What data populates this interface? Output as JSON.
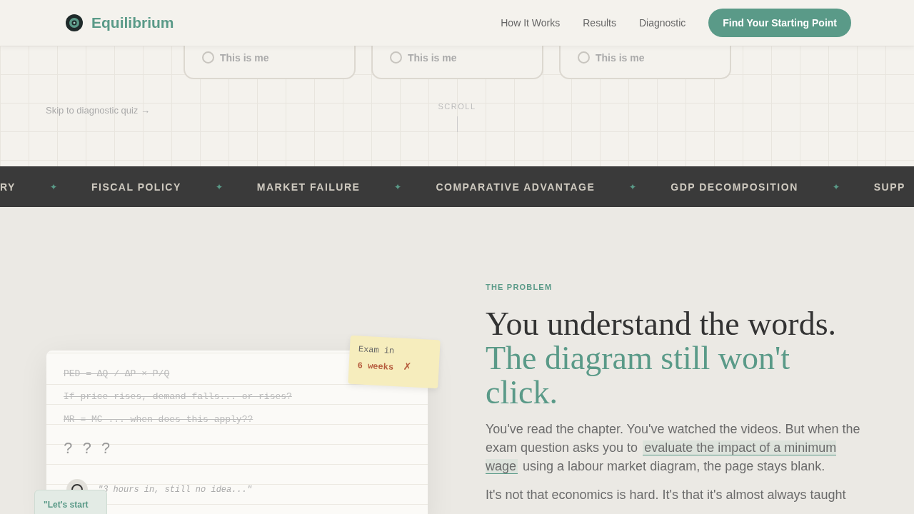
{
  "header": {
    "brand": "Equilibrium",
    "nav": [
      "How It Works",
      "Results",
      "Diagnostic"
    ],
    "cta": "Find Your Starting Point"
  },
  "hero": {
    "cards": [
      {
        "option": "This is me",
        "selected": false
      },
      {
        "option": "This is me",
        "selected": false
      },
      {
        "option": "This is me",
        "selected": false
      }
    ],
    "skip_link": "Skip to diagnostic quiz →",
    "scroll_hint": "SCROLL"
  },
  "ticker": {
    "items": [
      "RY",
      "FISCAL POLICY",
      "MARKET FAILURE",
      "COMPARATIVE ADVANTAGE",
      "GDP DECOMPOSITION",
      "SUPP"
    ],
    "separator": "✦"
  },
  "problem": {
    "notebook": {
      "lines": [
        "PED = ΔQ / ΔP × P/Q",
        "If price rises, demand falls... or rises?",
        "MR = MC ... when does this apply??"
      ],
      "question_marks": "? ? ?",
      "quote": "\"3 hours in, still no idea...\""
    },
    "exam_note": {
      "label": "Exam in",
      "value": "6 weeks",
      "mark": "✗"
    },
    "side_note": "\"Let's start",
    "eyebrow": "THE PROBLEM",
    "heading": "You understand the words.",
    "heading_accent": "The diagram still won't click.",
    "paragraph": {
      "before": "You've read the chapter. You've watched the videos. But when the exam question asks you to ",
      "highlight": "evaluate the impact of a minimum wage",
      "after": " using a labour market diagram, the page stays blank."
    },
    "paragraph_2": "It's not that economics is hard. It's that it's almost always taught"
  }
}
